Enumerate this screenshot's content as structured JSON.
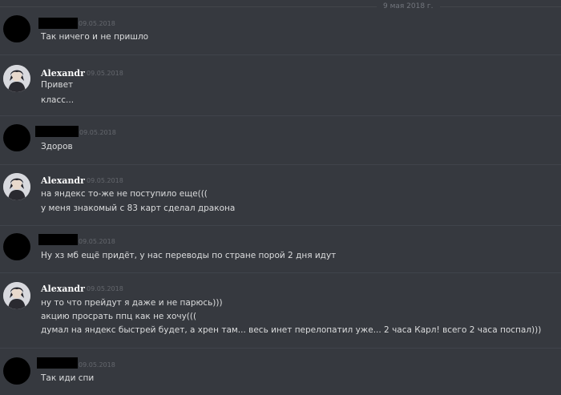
{
  "date_divider": "9 мая 2018 г.",
  "messages": [
    {
      "author": "",
      "timestamp": "09.05.2018",
      "lines": [
        "Так ничего и не пришло"
      ]
    },
    {
      "author": "Alexandr",
      "timestamp": "09.05.2018",
      "lines": [
        "Привет",
        "класс..."
      ]
    },
    {
      "author": "",
      "timestamp": "09.05.2018",
      "lines": [
        "Здоров"
      ]
    },
    {
      "author": "Alexandr",
      "timestamp": "09.05.2018",
      "lines": [
        "на яндекс то-же не поступило еще(((",
        "у меня знакомый с 83 карт сделал дракона"
      ]
    },
    {
      "author": "",
      "timestamp": "09.05.2018",
      "lines": [
        "Ну хз мб ещё придёт, у нас переводы по стране порой 2 дня идут"
      ]
    },
    {
      "author": "Alexandr",
      "timestamp": "09.05.2018",
      "lines": [
        "ну то что прейдут я даже и не парюсь)))",
        "акцию просрать ппц как не хочу(((",
        "думал на яндекс быстрей будет, а хрен там... весь инет перелопатил уже... 2 часа Карл! всего 2 часа поспал)))"
      ]
    },
    {
      "author": "",
      "timestamp": "09.05.2018",
      "lines": [
        "Так иди спи"
      ]
    }
  ]
}
